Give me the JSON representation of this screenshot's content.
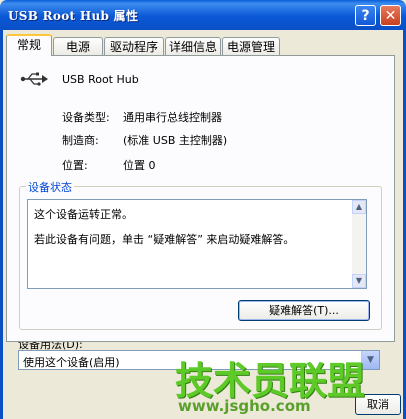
{
  "window": {
    "title": "USB Root Hub 属性"
  },
  "title_buttons": {
    "help": "?",
    "close": "✕"
  },
  "tabs": [
    {
      "label": "常规"
    },
    {
      "label": "电源"
    },
    {
      "label": "驱动程序"
    },
    {
      "label": "详细信息"
    },
    {
      "label": "电源管理"
    }
  ],
  "device": {
    "icon": "usb-icon",
    "name": "USB Root Hub",
    "type_label": "设备类型:",
    "type_value": "通用串行总线控制器",
    "maker_label": "制造商:",
    "maker_value": "(标准 USB 主控制器)",
    "location_label": "位置:",
    "location_value": "位置 0"
  },
  "status": {
    "title": "设备状态",
    "line1": "这个设备运转正常。",
    "line2": "若此设备有问题，单击 “疑难解答” 来启动疑难解答。",
    "troubleshoot_label": "疑难解答(T)..."
  },
  "usage": {
    "label": "设备用法(D):",
    "value": "使用这个设备(启用)"
  },
  "watermark": {
    "text": "技术员联盟",
    "url": "www.jsgho.com"
  },
  "bottom_buttons": {
    "cancel_partial": "取消"
  },
  "colors": {
    "title_bar": "#0a5fd8",
    "group_title": "#0046d5",
    "watermark": "#56c91f"
  }
}
